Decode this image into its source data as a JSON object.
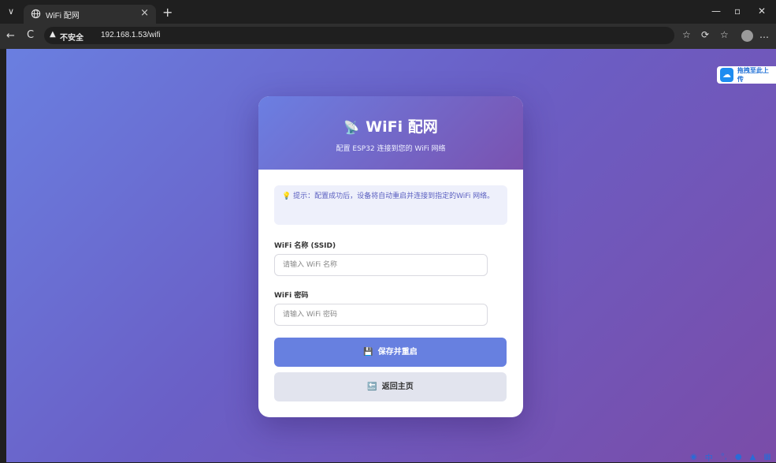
{
  "browser": {
    "tab_title": "WiFi 配网",
    "tab_close": "×",
    "new_tab": "+",
    "chevron": "∨",
    "window_controls": [
      "—",
      "▫",
      "✕"
    ],
    "security_label": "不安全",
    "url": "192.168.1.53/wifi",
    "nav_back": "←",
    "nav_reload": "C",
    "toolbar_icons": [
      "☆",
      "⟳",
      "☆",
      "…"
    ]
  },
  "upload_widget": {
    "label": "拖拽至此上传",
    "icon": "cloud-icon"
  },
  "card": {
    "title": "WiFi 配网",
    "title_icon": "satellite-dish-icon",
    "subtitle": "配置 ESP32 连接到您的 WiFi 网络",
    "tip": "提示：配置成功后，设备将自动重启并连接到指定的WiFi 网络。",
    "tip_icon": "lightbulb-icon",
    "ssid_label": "WiFi 名称 (SSID)",
    "ssid_placeholder": "请输入 WiFi 名称",
    "ssid_value": "",
    "password_label": "WiFi 密码",
    "password_placeholder": "请输入 WiFi 密码",
    "password_value": "",
    "save_button": "保存并重启",
    "save_icon": "floppy-disk-icon",
    "back_button": "返回主页",
    "back_icon": "back-arrow-icon"
  },
  "colors": {
    "accent": "#6780e0",
    "header_start": "#6b7fe2",
    "header_end": "#7a52b0",
    "page_bg_start": "#6a7fe0",
    "page_bg_end": "#7a4ca8"
  }
}
